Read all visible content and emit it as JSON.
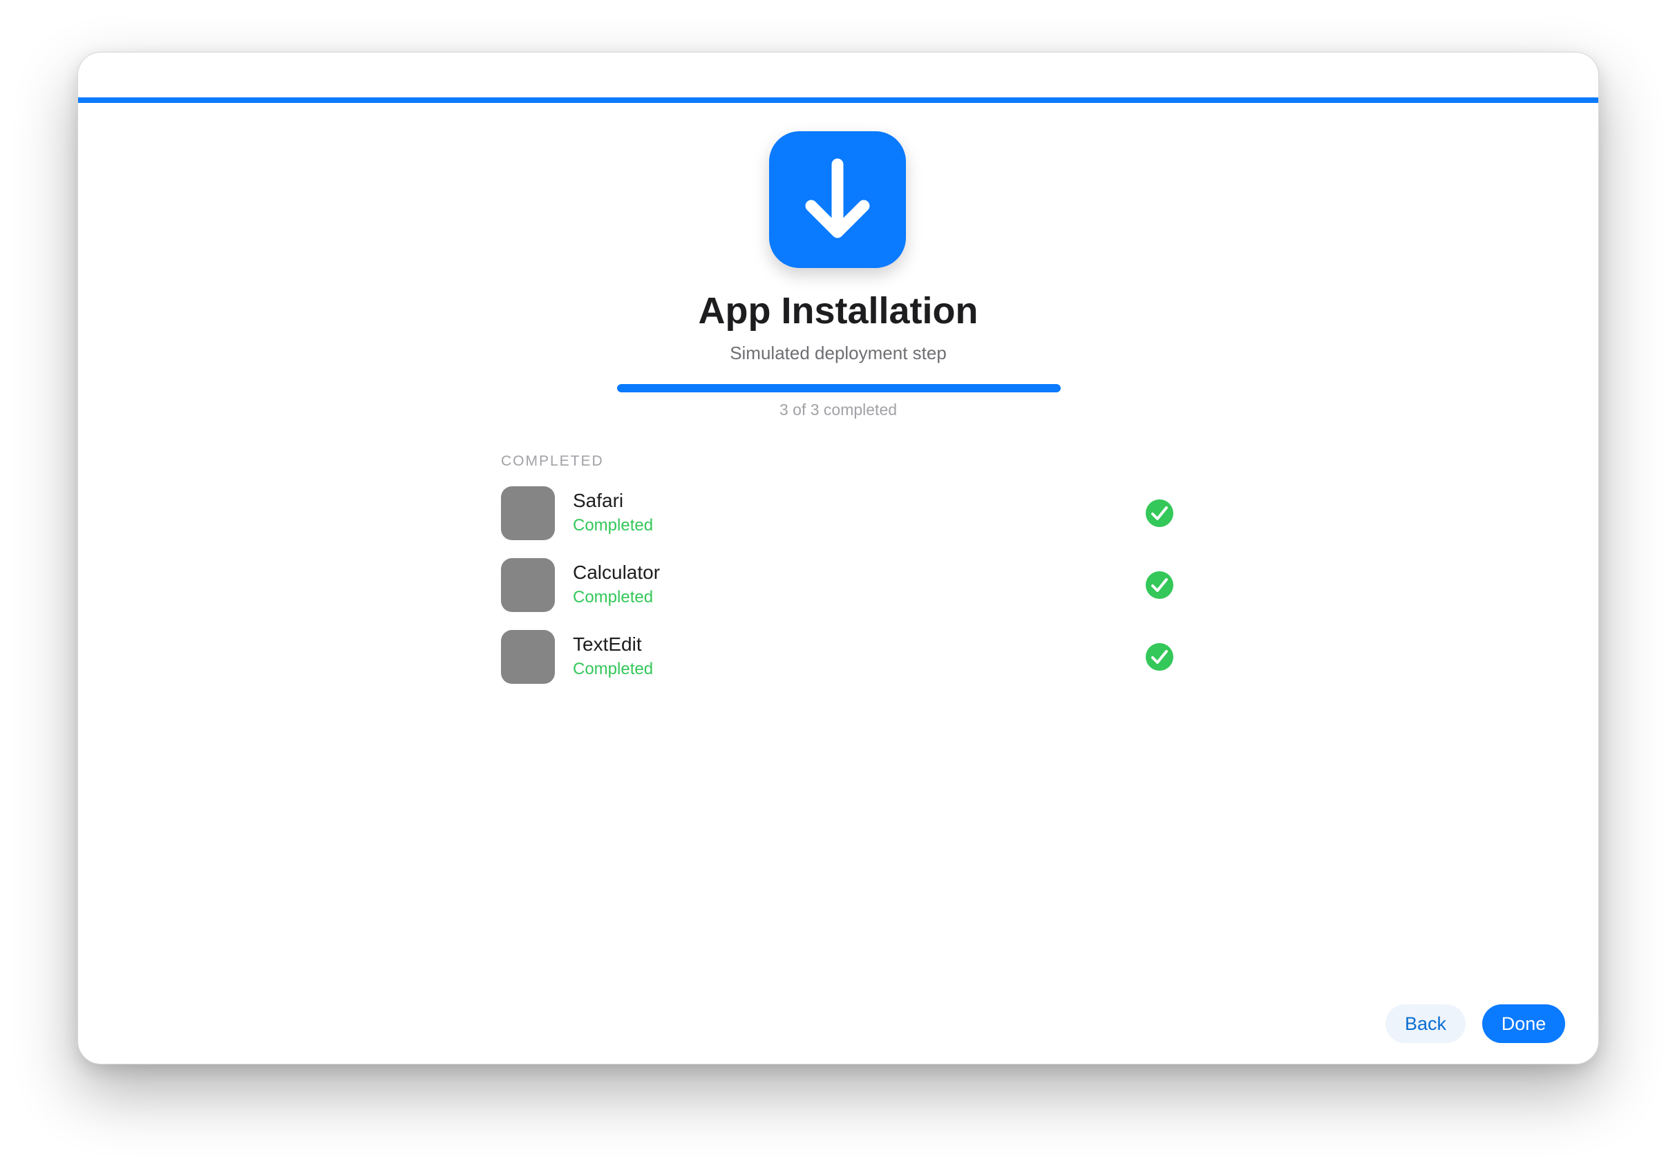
{
  "installer": {
    "icon": "download-arrow-icon",
    "title": "App Installation",
    "subtitle": "Simulated deployment step",
    "progress_fraction": 1.0,
    "progress_label": "3 of 3 completed",
    "accent_color": "#0a7aff",
    "success_color": "#34c759"
  },
  "section": {
    "header": "COMPLETED"
  },
  "apps": [
    {
      "name": "Safari",
      "status": "Completed",
      "icon": "checkmark-circle-icon"
    },
    {
      "name": "Calculator",
      "status": "Completed",
      "icon": "checkmark-circle-icon"
    },
    {
      "name": "TextEdit",
      "status": "Completed",
      "icon": "checkmark-circle-icon"
    }
  ],
  "footer": {
    "back_label": "Back",
    "done_label": "Done"
  }
}
